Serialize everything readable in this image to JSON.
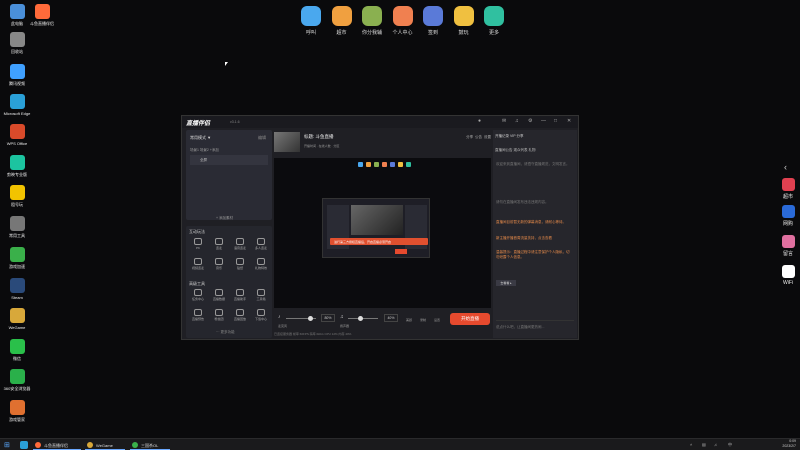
{
  "desktop_icons": [
    {
      "label": "此电脑",
      "color": "#4a8fd9"
    },
    {
      "label": "斗鱼直播伴侣",
      "color": "#ff6a3a"
    },
    {
      "label": "回收站",
      "color": "#888888"
    },
    {
      "label": "腾讯视频",
      "color": "#3fa0ff"
    },
    {
      "label": "Microsoft Edge",
      "color": "#2aa0d8"
    },
    {
      "label": "WPS Office",
      "color": "#d94a2a"
    },
    {
      "label": "剪映专业版",
      "color": "#1cc4a0"
    },
    {
      "label": "租号玩",
      "color": "#f2c300"
    },
    {
      "label": "常用工具",
      "color": "#777777"
    },
    {
      "label": "游戏加速",
      "color": "#3ab04a"
    },
    {
      "label": "Steam",
      "color": "#2a4a7a"
    },
    {
      "label": "WeGame",
      "color": "#d8a83a"
    },
    {
      "label": "微信",
      "color": "#2ac04a"
    },
    {
      "label": "360安全浏览器",
      "color": "#2ab04a"
    },
    {
      "label": "游戏管家",
      "color": "#e07030"
    }
  ],
  "dock": [
    {
      "label": "呼叫",
      "color": "#4aa8ee"
    },
    {
      "label": "超市",
      "color": "#f0a040"
    },
    {
      "label": "你分我辅",
      "color": "#8ab050"
    },
    {
      "label": "个人中心",
      "color": "#f08050"
    },
    {
      "label": "签到",
      "color": "#5a7ad8"
    },
    {
      "label": "鼓玩",
      "color": "#f0c040"
    },
    {
      "label": "更多",
      "color": "#30c0a0"
    }
  ],
  "right_bar": [
    {
      "label": "超市",
      "color": "#e04050"
    },
    {
      "label": "网购",
      "color": "#2a6ad8"
    },
    {
      "label": "留言",
      "color": "#e070a0"
    },
    {
      "label": "WiFi",
      "color": "#ffffff"
    }
  ],
  "window": {
    "logo": "直播伴侣",
    "version": "v3.1.6",
    "scene": {
      "header": "常用模式 ▼",
      "header_action": "编辑",
      "tabs": "场景1  场景2  +添加",
      "source": "全屏",
      "add_source": "+ 添加素材"
    },
    "interact_title": "互动玩法",
    "interact_tools": [
      "PK",
      "连麦",
      "语音连麦",
      "多人连麦",
      "视频连麦",
      "音乐",
      "贴纸",
      "礼物特效"
    ],
    "tools_title": "高级工具",
    "advanced_tools": [
      "任务中心",
      "直播数据",
      "直播助手",
      "工具箱",
      "直播预告",
      "粉丝团",
      "直播回放",
      "下载中心"
    ],
    "more_label": "··· 更多功能",
    "stream": {
      "title": "标题: 斗鱼直播",
      "tags": "开播时间 · 在线人数 · 分区",
      "actions": [
        "分享",
        "公告",
        "设置"
      ]
    },
    "toast": "进行第三方授权直播后，开启直播必须开启",
    "controls": {
      "mic_label": "麦克风",
      "mic_pct": "80%",
      "speaker_label": "扬声器",
      "speaker_pct": "40%",
      "mic_level": 0.8,
      "speaker_level": 0.4,
      "icons": [
        "美颜",
        "录制",
        "设置"
      ],
      "go_live": "开始直播",
      "status": "已连接服务器  帧率 60FPS  码率 0kb/s  CPU 12%  内存 40%"
    },
    "right": {
      "top_actions": "开播记录  VIP  分享",
      "tabs": "直播间公告   观众列表   礼物",
      "chat_lines": [
        "欢迎来到直播间，请遵守直播规范，文明发言。",
        "请勿在直播间发布违法违规内容。",
        "直播间目前暂无新的弹幕消息，请耐心等待。",
        "新主播开播首周流量扶持，点击查看",
        "温馨提示：直播过程中请注意保护个人隐私，切勿泄露个人信息。"
      ],
      "chat_tag": "去看看 ▸",
      "input_placeholder": "说点什么吧，让直播间更热闹..."
    }
  },
  "taskbar": {
    "apps": [
      "斗鱼直播伴侣",
      "WeGame",
      "三国杀OL"
    ],
    "time": "0:09",
    "date": "2023/2/7"
  }
}
